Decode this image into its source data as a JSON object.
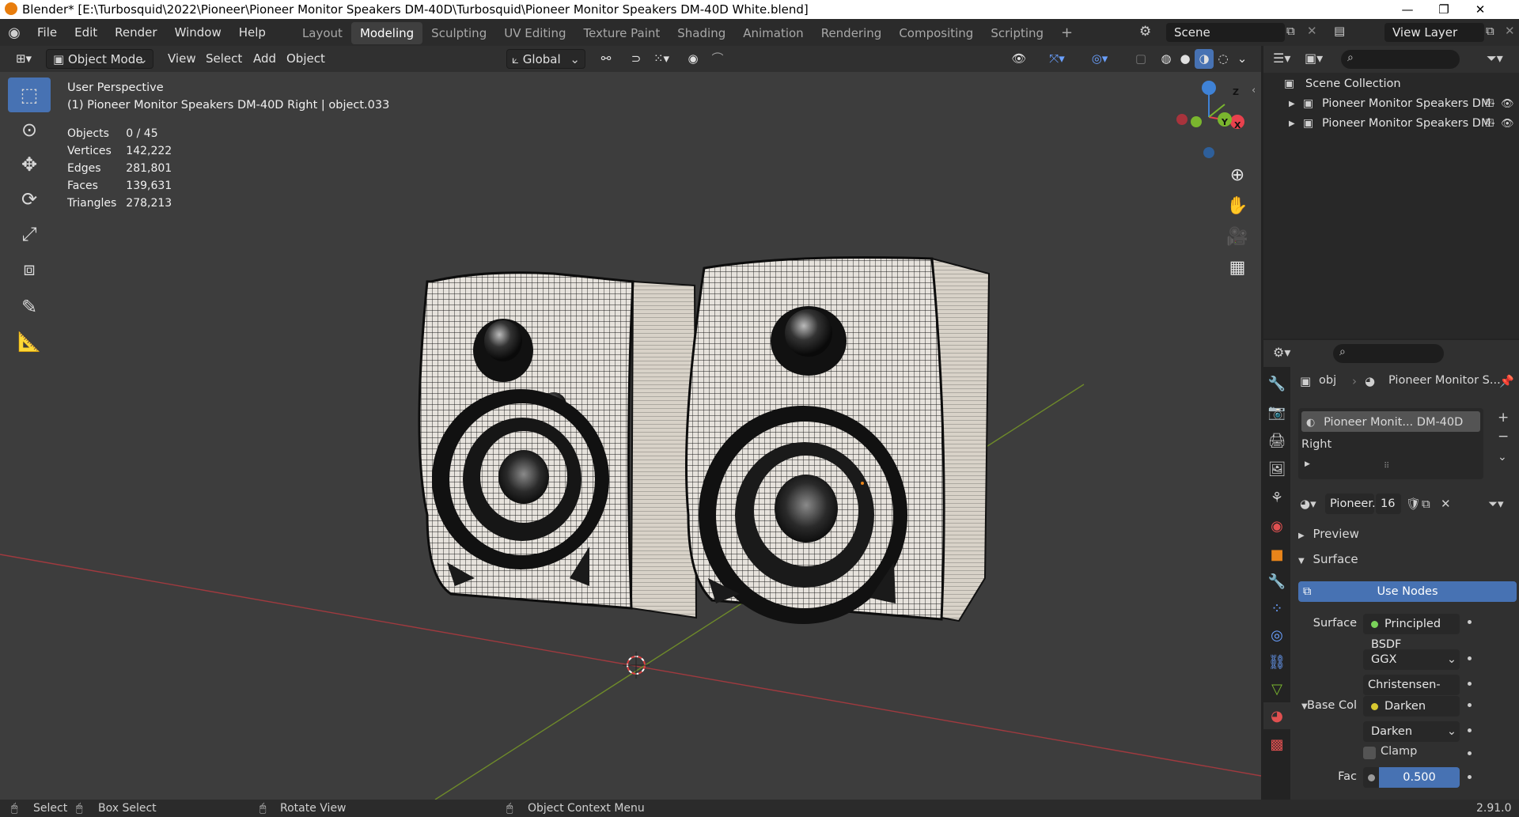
{
  "window": {
    "title": "Blender* [E:\\Turbosquid\\2022\\Pioneer\\Pioneer Monitor Speakers DM-40D\\Turbosquid\\Pioneer Monitor Speakers DM-40D  White.blend]",
    "minimize": "—",
    "maximize": "❐",
    "close": "✕"
  },
  "menu": {
    "items": [
      "File",
      "Edit",
      "Render",
      "Window",
      "Help"
    ],
    "workspaces": [
      "Layout",
      "Modeling",
      "Sculpting",
      "UV Editing",
      "Texture Paint",
      "Shading",
      "Animation",
      "Rendering",
      "Compositing",
      "Scripting"
    ],
    "active_workspace": "Modeling",
    "add_workspace": "+",
    "scene": "Scene",
    "view_layer": "View Layer"
  },
  "viewport_header": {
    "mode": "Object Mode",
    "menus": [
      "View",
      "Select",
      "Add",
      "Object"
    ],
    "transform_orientation": "Global"
  },
  "viewport": {
    "perspective": "User Perspective",
    "active_object": "(1) Pioneer Monitor Speakers DM-40D Right | object.033",
    "stats": [
      {
        "label": "Objects",
        "value": "0 / 45"
      },
      {
        "label": "Vertices",
        "value": "142,222"
      },
      {
        "label": "Edges",
        "value": "281,801"
      },
      {
        "label": "Faces",
        "value": "139,631"
      },
      {
        "label": "Triangles",
        "value": "278,213"
      }
    ],
    "gizmo_axes": {
      "x": "X",
      "y": "Y",
      "z": "Z"
    },
    "colors": {
      "x_axis": "#e8414d",
      "y_axis": "#7ab62e",
      "z_axis": "#3f82d6",
      "grid_line_x": "#a03a3f",
      "grid_line_y": "#6e8a2a",
      "background": "#3d3d3d",
      "selection": "#4772b3"
    }
  },
  "outliner": {
    "root": "Scene Collection",
    "items": [
      "Pioneer Monitor Speakers DM-",
      "Pioneer Monitor Speakers DM-"
    ]
  },
  "properties": {
    "breadcrumb_object": "obj",
    "breadcrumb_material": "Pioneer Monitor S...",
    "slot": "Pioneer Monit... DM-40D Right",
    "material_name": "Pioneer...",
    "user_count": "16",
    "panels": {
      "preview": "Preview",
      "surface": "Surface"
    },
    "use_nodes": "Use Nodes",
    "surface_label": "Surface",
    "surface_value": "Principled BSDF",
    "distribution": "GGX",
    "subsurface_method": "Christensen-Burley",
    "base_color_label": "Base Col",
    "base_color_node": "Darken",
    "blend_mode": "Darken",
    "clamp_label": "Clamp",
    "fac_label": "Fac",
    "fac_value": "0.500"
  },
  "statusbar": {
    "select": "Select",
    "box_select": "Box Select",
    "rotate_view": "Rotate View",
    "context_menu": "Object Context Menu",
    "version": "2.91.0"
  }
}
